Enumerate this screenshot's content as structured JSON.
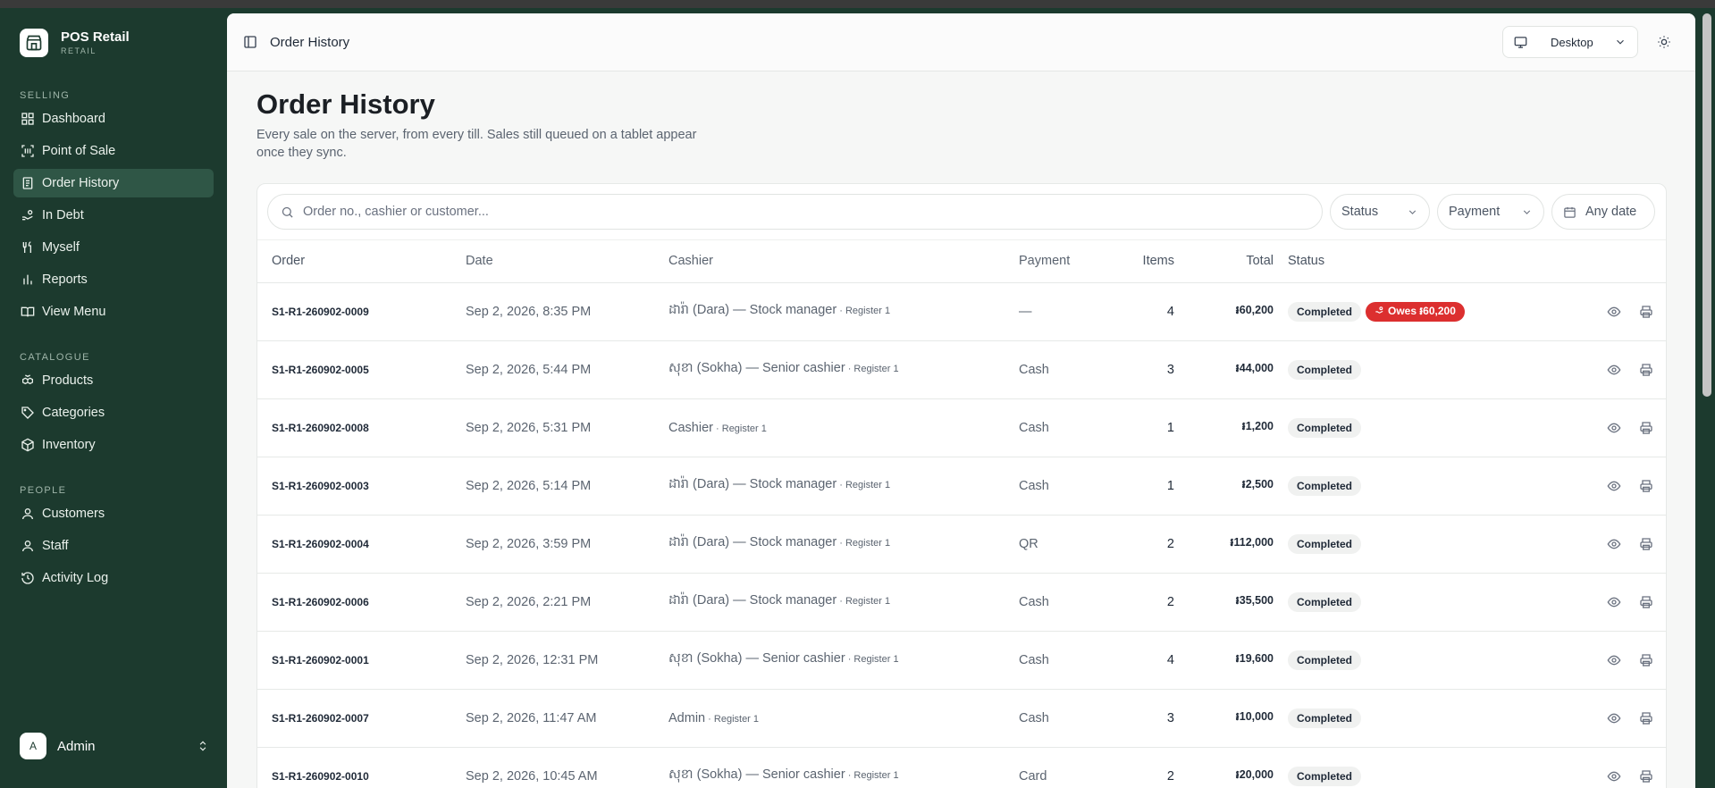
{
  "app": {
    "name": "POS Retail",
    "subtitle": "RETAIL"
  },
  "sidebar": {
    "sections": [
      {
        "label": "SELLING",
        "items": [
          {
            "label": "Dashboard",
            "icon": "dashboard-icon"
          },
          {
            "label": "Point of Sale",
            "icon": "scan-icon"
          },
          {
            "label": "Order History",
            "icon": "receipt-icon",
            "active": true
          },
          {
            "label": "In Debt",
            "icon": "hand-coins-icon"
          },
          {
            "label": "Myself",
            "icon": "utensils-icon"
          },
          {
            "label": "Reports",
            "icon": "bar-chart-icon"
          },
          {
            "label": "View Menu",
            "icon": "book-open-icon"
          }
        ]
      },
      {
        "label": "CATALOGUE",
        "items": [
          {
            "label": "Products",
            "icon": "boxes-icon"
          },
          {
            "label": "Categories",
            "icon": "tag-icon"
          },
          {
            "label": "Inventory",
            "icon": "package-icon"
          }
        ]
      },
      {
        "label": "PEOPLE",
        "items": [
          {
            "label": "Customers",
            "icon": "user-icon"
          },
          {
            "label": "Staff",
            "icon": "user-icon"
          },
          {
            "label": "Activity Log",
            "icon": "history-icon"
          }
        ]
      }
    ],
    "user": {
      "initial": "A",
      "name": "Admin"
    }
  },
  "header": {
    "title": "Order History",
    "device": "Desktop"
  },
  "page": {
    "title": "Order History",
    "description": "Every sale on the server, from every till. Sales still queued on a tablet appear once they sync."
  },
  "filters": {
    "search_placeholder": "Order no., cashier or customer...",
    "status": "Status",
    "payment": "Payment",
    "date": "Any date"
  },
  "table": {
    "columns": [
      "Order",
      "Date",
      "Cashier",
      "Payment",
      "Items",
      "Total",
      "Status"
    ],
    "rows": [
      {
        "order": "S1-R1-260902-0009",
        "date": "Sep 2, 2026, 8:35 PM",
        "cashier": "ដារ៉ា (Dara) — Stock manager",
        "register": " · Register 1",
        "payment": "—",
        "items": "4",
        "total": "៛60,200",
        "status": "Completed",
        "owes": "Owes ៛60,200"
      },
      {
        "order": "S1-R1-260902-0005",
        "date": "Sep 2, 2026, 5:44 PM",
        "cashier": "សុខា (Sokha) — Senior cashier",
        "register": " · Register 1",
        "payment": "Cash",
        "items": "3",
        "total": "៛44,000",
        "status": "Completed"
      },
      {
        "order": "S1-R1-260902-0008",
        "date": "Sep 2, 2026, 5:31 PM",
        "cashier": "Cashier",
        "register": " · Register 1",
        "payment": "Cash",
        "items": "1",
        "total": "៛1,200",
        "status": "Completed"
      },
      {
        "order": "S1-R1-260902-0003",
        "date": "Sep 2, 2026, 5:14 PM",
        "cashier": "ដារ៉ា (Dara) — Stock manager",
        "register": " · Register 1",
        "payment": "Cash",
        "items": "1",
        "total": "៛2,500",
        "status": "Completed"
      },
      {
        "order": "S1-R1-260902-0004",
        "date": "Sep 2, 2026, 3:59 PM",
        "cashier": "ដារ៉ា (Dara) — Stock manager",
        "register": " · Register 1",
        "payment": "QR",
        "items": "2",
        "total": "៛112,000",
        "status": "Completed"
      },
      {
        "order": "S1-R1-260902-0006",
        "date": "Sep 2, 2026, 2:21 PM",
        "cashier": "ដារ៉ា (Dara) — Stock manager",
        "register": " · Register 1",
        "payment": "Cash",
        "items": "2",
        "total": "៛35,500",
        "status": "Completed"
      },
      {
        "order": "S1-R1-260902-0001",
        "date": "Sep 2, 2026, 12:31 PM",
        "cashier": "សុខា (Sokha) — Senior cashier",
        "register": " · Register 1",
        "payment": "Cash",
        "items": "4",
        "total": "៛19,600",
        "status": "Completed"
      },
      {
        "order": "S1-R1-260902-0007",
        "date": "Sep 2, 2026, 11:47 AM",
        "cashier": "Admin",
        "register": " · Register 1",
        "payment": "Cash",
        "items": "3",
        "total": "៛10,000",
        "status": "Completed"
      },
      {
        "order": "S1-R1-260902-0010",
        "date": "Sep 2, 2026, 10:45 AM",
        "cashier": "សុខា (Sokha) — Senior cashier",
        "register": " · Register 1",
        "payment": "Card",
        "items": "2",
        "total": "៛20,000",
        "status": "Completed"
      }
    ]
  },
  "colors": {
    "sidebar": "#1c3a2e",
    "active_nav": "#2f5646",
    "danger": "#dc2f2f",
    "badge_bg": "#f0f1f0"
  }
}
